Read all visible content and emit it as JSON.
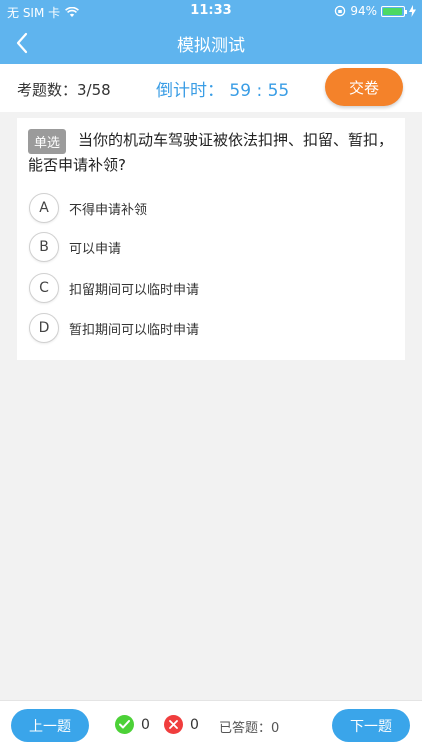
{
  "status": {
    "carrier": "无 SIM 卡",
    "time": "11:33",
    "battery": "94%",
    "battery_level": 0.94
  },
  "nav": {
    "title": "模拟测试"
  },
  "info": {
    "count_label": "考题数：3/58",
    "countdown_label": "倒计时：",
    "countdown_value": "59 : 55",
    "submit": "交卷"
  },
  "question": {
    "type": "单选",
    "text": "当你的机动车驾驶证被依法扣押、扣留、暂扣，能否申请补领?",
    "options": [
      {
        "letter": "A",
        "text": "不得申请补领"
      },
      {
        "letter": "B",
        "text": "可以申请"
      },
      {
        "letter": "C",
        "text": "扣留期间可以临时申请"
      },
      {
        "letter": "D",
        "text": "暂扣期间可以临时申请"
      }
    ]
  },
  "footer": {
    "prev": "上一题",
    "correct_count": "0",
    "wrong_count": "0",
    "answered_label": "已答题：",
    "answered_value": "0",
    "next": "下一题"
  },
  "colors": {
    "primary": "#5fb4ee",
    "accent": "#f4822a",
    "correct": "#4cd137",
    "wrong": "#f03d3d"
  }
}
